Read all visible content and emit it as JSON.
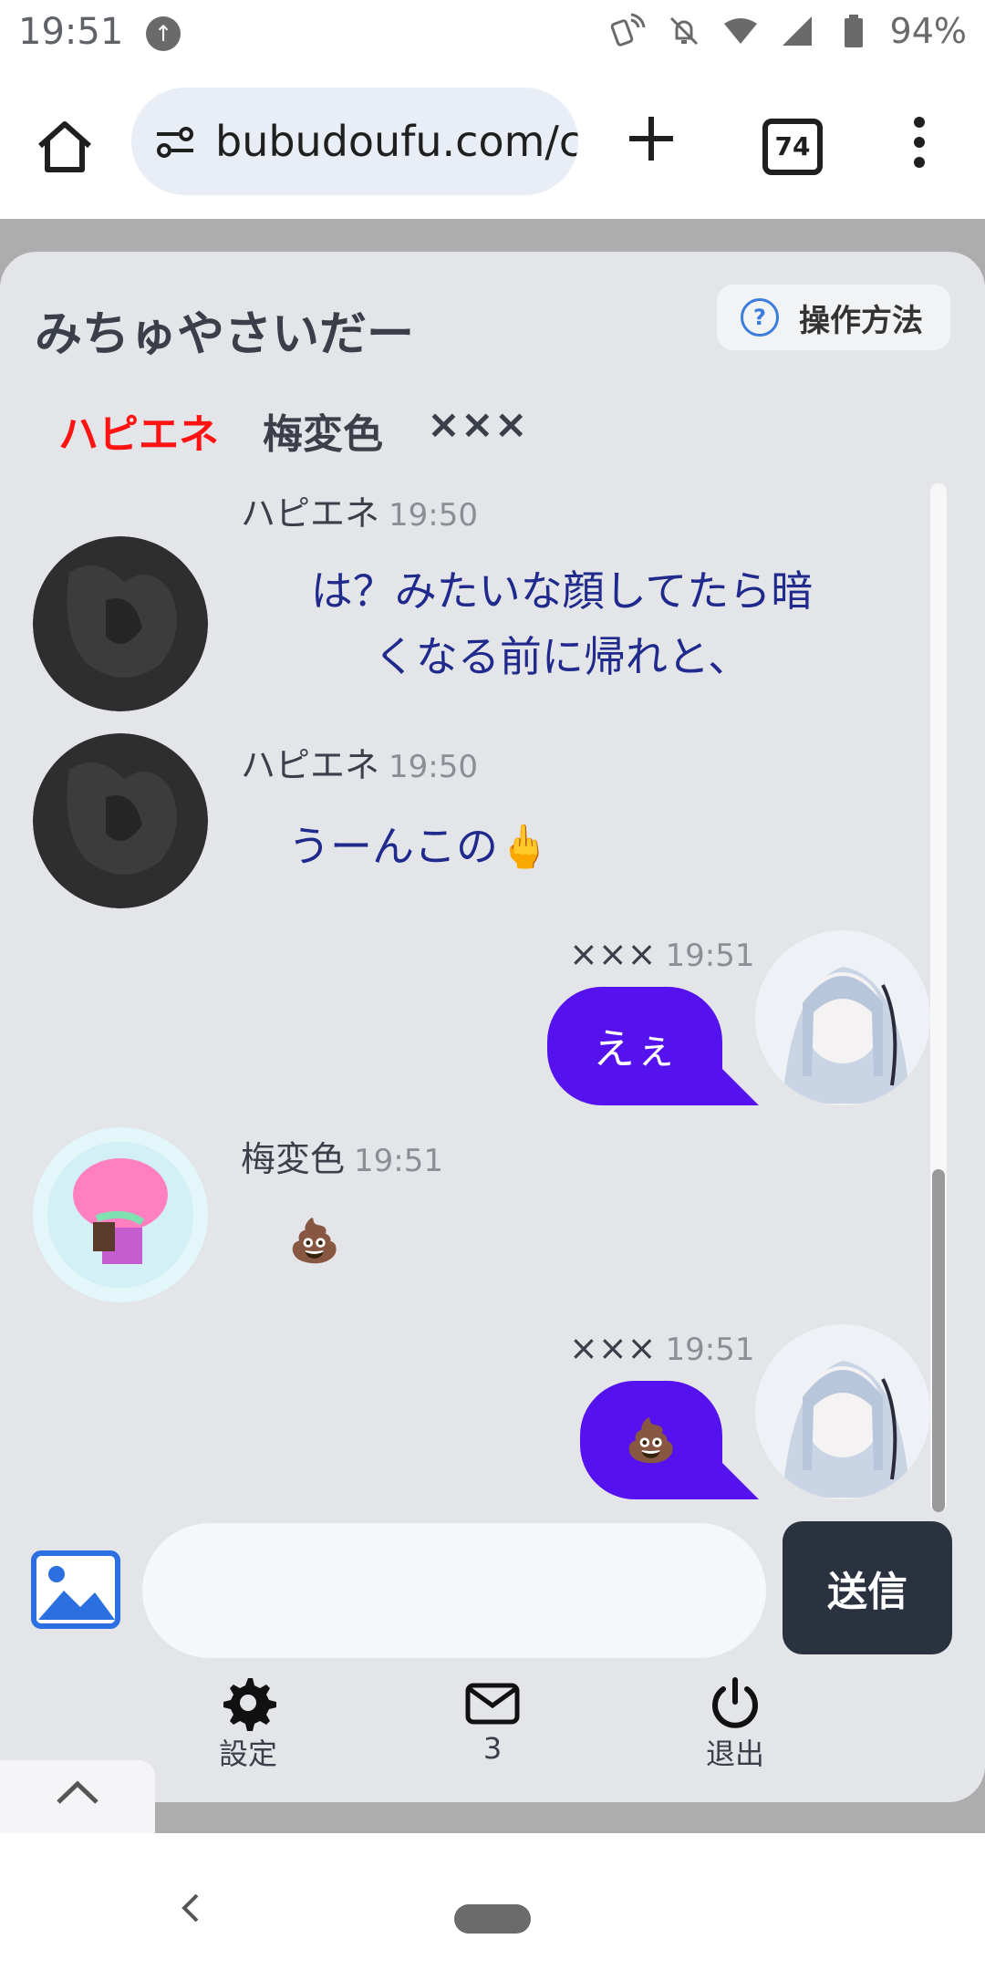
{
  "status_bar": {
    "time": "19:51",
    "battery": "94%"
  },
  "browser": {
    "url": "bubudoufu.com/c",
    "tab_count": "74"
  },
  "chat": {
    "room_title": "みちゅやさいだー",
    "help_label": "操作方法",
    "members": [
      "ハピエネ",
      "梅変色",
      "×××"
    ],
    "messages": [
      {
        "sender": "ハピエネ",
        "time": "19:50",
        "text": "は？みたいな顔してたら暗くなる前に帰れと、",
        "line1": "は？みたいな顔してたら暗",
        "line2": "くなる前に帰れと、"
      },
      {
        "sender": "ハピエネ",
        "time": "19:50",
        "text": "うーんこの🖕"
      },
      {
        "sender": "×××",
        "time": "19:51",
        "text": "えぇ"
      },
      {
        "sender": "梅変色",
        "time": "19:51",
        "text": "💩"
      },
      {
        "sender": "×××",
        "time": "19:51",
        "text": "💩"
      }
    ]
  },
  "composer": {
    "send_label": "送信",
    "placeholder": ""
  },
  "bottom_nav": {
    "settings_label": "設定",
    "mail_count": "3",
    "logout_label": "退出"
  },
  "colors": {
    "accent": "#5511ee",
    "card_bg": "#e4e5e9",
    "send_bg": "#2a323f",
    "member_highlight": "#ff1212",
    "message_text": "#1f2a8c"
  },
  "icons": [
    "upload-icon",
    "nfc-icon",
    "bell-off-icon",
    "wifi-icon",
    "signal-icon",
    "battery-icon",
    "home-icon",
    "tune-icon",
    "plus-icon",
    "more-icon",
    "help-icon",
    "image-icon",
    "gear-icon",
    "mail-icon",
    "power-icon",
    "chevron-up-icon",
    "back-icon"
  ]
}
